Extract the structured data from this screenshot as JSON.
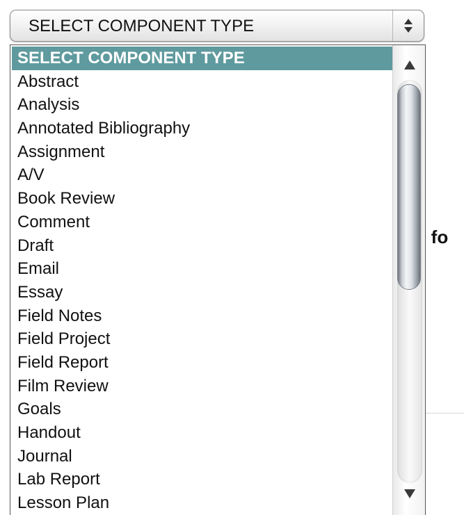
{
  "select": {
    "value": "SELECT COMPONENT TYPE"
  },
  "dropdown": {
    "options": [
      {
        "label": "SELECT COMPONENT TYPE",
        "selected": true
      },
      {
        "label": "Abstract"
      },
      {
        "label": "Analysis"
      },
      {
        "label": "Annotated Bibliography"
      },
      {
        "label": "Assignment"
      },
      {
        "label": "A/V"
      },
      {
        "label": "Book Review"
      },
      {
        "label": "Comment"
      },
      {
        "label": "Draft"
      },
      {
        "label": "Email"
      },
      {
        "label": "Essay"
      },
      {
        "label": "Field Notes"
      },
      {
        "label": "Field Project"
      },
      {
        "label": "Field Report"
      },
      {
        "label": "Film Review"
      },
      {
        "label": "Goals"
      },
      {
        "label": "Handout"
      },
      {
        "label": "Journal"
      },
      {
        "label": "Lab Report"
      },
      {
        "label": "Lesson Plan"
      }
    ],
    "highlight_color": "#5f9a9e"
  },
  "background": {
    "partial_text": "e fo"
  },
  "icons": {
    "select_arrows": "up-down-chevron-icon",
    "scroll_up": "scroll-up-arrow-icon",
    "scroll_down": "scroll-down-arrow-icon"
  }
}
